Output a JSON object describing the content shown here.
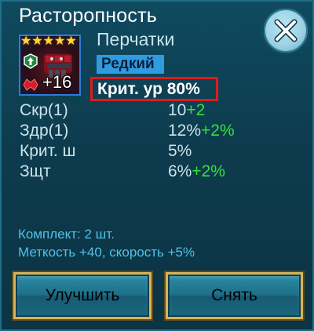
{
  "window": {
    "title": "Расторопность",
    "close_icon": "close-icon"
  },
  "item": {
    "name": "Перчатки",
    "rarity": "Редкий",
    "main_stat": "Крит. ур 80%",
    "stars_count": 5,
    "level": "+16",
    "icons": [
      "star-icon",
      "rank-up-icon",
      "gauntlet-icon",
      "set-icon"
    ]
  },
  "stats": [
    {
      "name": "Скр(1)",
      "value": "10",
      "bonus": "+2"
    },
    {
      "name": "Здр(1)",
      "value": "12%",
      "bonus": "+2%"
    },
    {
      "name": "Крит. ш",
      "value": "5%",
      "bonus": ""
    },
    {
      "name": "Зщт",
      "value": "6%",
      "bonus": "+2%"
    }
  ],
  "set_bonus": {
    "line1": "Комплект: 2 шт.",
    "line2": "Меткость +40, скорость +5%"
  },
  "buttons": {
    "upgrade_label": "Улучшить",
    "remove_label": "Снять"
  },
  "colors": {
    "background": "#0d3b4d",
    "text": "#cbe3ea",
    "bonus": "#34e23a",
    "set_text": "#52c2e6",
    "rarity_bg": "#2f9be0",
    "highlight_border": "#e01b1b",
    "button_border": "#d9b455"
  }
}
